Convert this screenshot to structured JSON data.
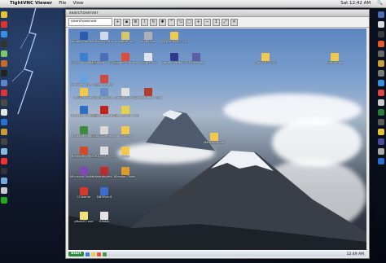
{
  "mac_menubar": {
    "app": "TightVNC Viewer",
    "items": [
      "File",
      "View"
    ],
    "clock": "Sat 12:42 AM"
  },
  "vnc_window": {
    "title": "searchoserver",
    "address": "searchoserver",
    "toolbar_buttons": [
      "new",
      "save",
      "options",
      "info",
      "refresh",
      "ctrl-alt-del",
      "ctrl",
      "alt",
      "full-screen",
      "zoom-in",
      "zoom-out",
      "zoom-100",
      "zoom-fit",
      "disconnect"
    ]
  },
  "remote_desktop": {
    "icons": [
      {
        "label": "October Refresh.do",
        "icon": "doc-icon",
        "color": "#2a5db0"
      },
      {
        "label": "Recycle Bin",
        "icon": "recycle-bin-icon",
        "color": "#cfd8e6"
      },
      {
        "label": "powered_se...",
        "icon": "image-icon",
        "color": "#d9c66b"
      },
      {
        "label": "glyfis.exe",
        "icon": "exe-icon",
        "color": "#b0b0b0"
      },
      {
        "label": "SNDPack Mi...1.2.6...",
        "icon": "folder-icon",
        "color": "#f2c94c"
      },
      {
        "label": "SciTec Mobile DSL Hel...",
        "icon": "app-icon",
        "color": "#3c7fd0"
      },
      {
        "label": "Microsoft 1 in Dea...",
        "icon": "app-icon",
        "color": "#4d6fb8"
      },
      {
        "label": "Google Chrome",
        "icon": "chrome-icon",
        "color": "#e04b3a"
      },
      {
        "label": "Google SoY",
        "icon": "app-icon",
        "color": "#dfe4ea"
      },
      {
        "label": "Adobe Photos 25CC",
        "icon": "app-icon",
        "color": "#2e3a8c"
      },
      {
        "label": "Windows Live Messenger",
        "icon": "app-icon",
        "color": "#67a1e0"
      },
      {
        "label": "StartSmart",
        "icon": "app-icon",
        "color": "#d04a3d"
      },
      {
        "label": "WinDPreview",
        "icon": "folder-icon",
        "color": "#f2c94c"
      },
      {
        "label": "thunderbolt...",
        "icon": "app-icon",
        "color": "#6b8fc4"
      },
      {
        "label": "Uncheck PMC",
        "icon": "app-icon",
        "color": "#e0e0e0"
      },
      {
        "label": "Adventure in Typing",
        "icon": "app-icon",
        "color": "#b33b2b"
      },
      {
        "label": "Microsoft Office Ex...",
        "icon": "office-icon",
        "color": "#2f6fc2"
      },
      {
        "label": "Adobe Reader 9",
        "icon": "pdf-icon",
        "color": "#c2221b"
      },
      {
        "label": "I The Beatles Yellow Subm...",
        "icon": "music-icon",
        "color": "#e6d04c"
      },
      {
        "label": "Microsoft Office Ex...",
        "icon": "office-icon",
        "color": "#3c8c3c"
      },
      {
        "label": "RYDC Computer u...",
        "icon": "app-icon",
        "color": "#d8d8d8"
      },
      {
        "label": "Politics",
        "icon": "folder-icon",
        "color": "#f2c94c"
      },
      {
        "label": "Microsoft Office P...",
        "icon": "office-icon",
        "color": "#d14a2a"
      },
      {
        "label": "1001000_3_0...",
        "icon": "doc-icon",
        "color": "#dcdcdc"
      },
      {
        "label": "Poltry",
        "icon": "folder-icon",
        "color": "#f2c94c"
      },
      {
        "label": "Microsoft Visual Studio 2008",
        "icon": "app-icon",
        "color": "#7d4ab5"
      },
      {
        "label": "Malwarebytes' Anti-Malware",
        "icon": "app-icon",
        "color": "#c22b2b"
      },
      {
        "label": "Dragon Tales",
        "icon": "app-icon",
        "color": "#e09a2a"
      },
      {
        "label": "CCleaner",
        "icon": "app-icon",
        "color": "#d23b2b"
      },
      {
        "label": "DNSPub 6",
        "icon": "app-icon",
        "color": "#3a6ed0"
      },
      {
        "label": "pfiost02.exe",
        "icon": "exe-icon",
        "color": "#f0e27a"
      },
      {
        "label": "Kindle",
        "icon": "app-icon",
        "color": "#e2e2e2"
      },
      {
        "label": "TightVNC 5.00",
        "icon": "folder-icon",
        "color": "#f2c94c"
      },
      {
        "label": "TeamViewer",
        "icon": "folder-icon",
        "color": "#f2c94c"
      },
      {
        "label": "Srufances",
        "icon": "app-icon",
        "color": "#5d5ea8"
      },
      {
        "label": "Malwarebytes",
        "icon": "folder-icon",
        "color": "#f2c94c"
      }
    ],
    "taskbar": {
      "start_label": "Start",
      "clock": "12:49 AM"
    }
  },
  "dock_left": [
    "#e8c23a",
    "#d33",
    "#3a8fe0",
    "#333",
    "#7bc96f",
    "#c86b2a",
    "#222",
    "#5b87c9",
    "#d33",
    "#4a4a4a",
    "#e8e8e8",
    "#2b6fd0",
    "#c93",
    "#444",
    "#8bd",
    "#e33",
    "#333",
    "#7ad",
    "#ccc",
    "#2a2"
  ],
  "dock_right": [
    "#4a6db5",
    "#ddd",
    "#3a3a3a",
    "#e05a2a",
    "#666",
    "#c9a040",
    "#7b7b7b",
    "#3a8fe0",
    "#d44",
    "#ccc",
    "#2a7a3a",
    "#5a5a5a",
    "#e8c23a",
    "#4a4a9a",
    "#aaa",
    "#2b6fd0"
  ]
}
